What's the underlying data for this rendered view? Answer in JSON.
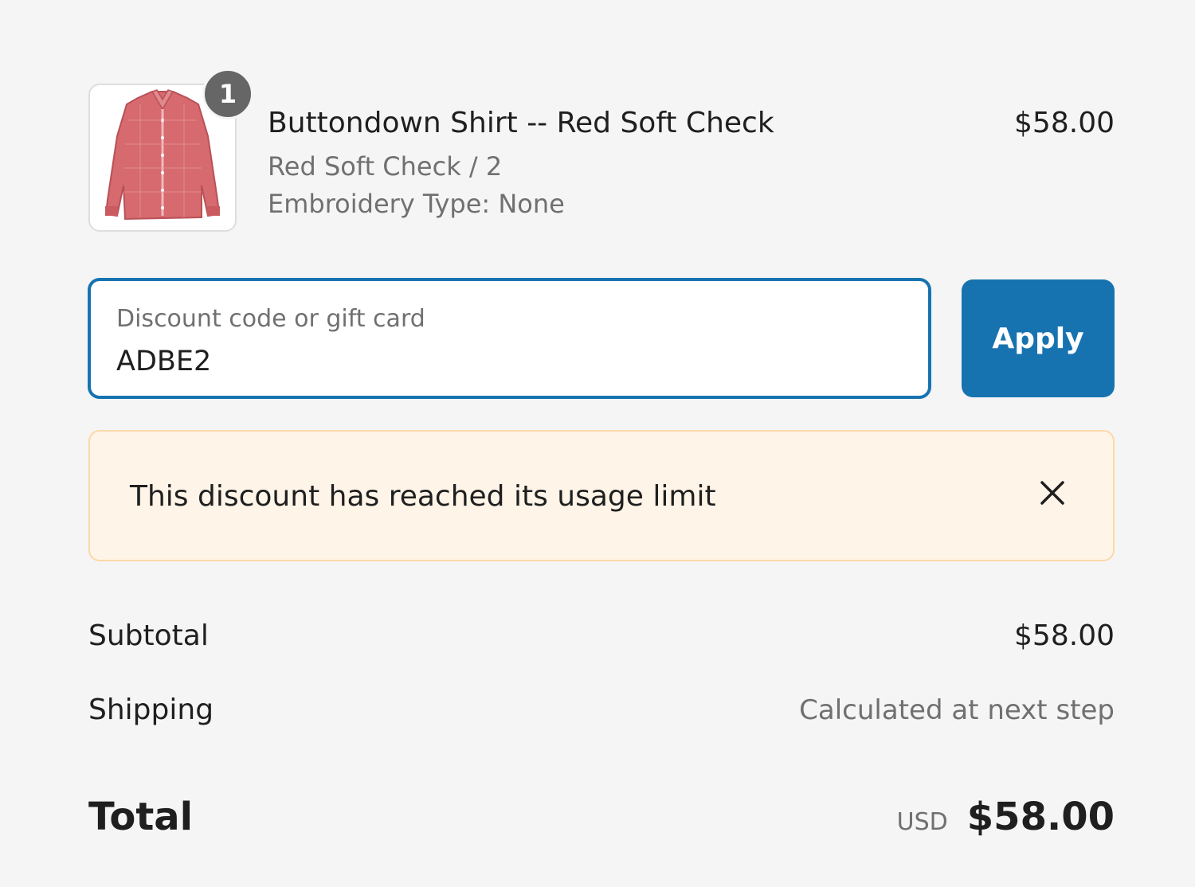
{
  "line_item": {
    "quantity": "1",
    "title": "Buttondown Shirt -- Red Soft Check",
    "variant": "Red Soft Check / 2",
    "option": "Embroidery Type: None",
    "price": "$58.00",
    "image_icon": "shirt-image"
  },
  "discount": {
    "label": "Discount code or gift card",
    "value": "ADBE2",
    "apply_label": "Apply"
  },
  "banner": {
    "message": "This discount has reached its usage limit",
    "close_icon": "close-icon"
  },
  "summary": {
    "subtotal_label": "Subtotal",
    "subtotal_value": "$58.00",
    "shipping_label": "Shipping",
    "shipping_value": "Calculated at next step",
    "total_label": "Total",
    "currency": "USD",
    "total_value": "$58.00"
  },
  "colors": {
    "accent": "#1773b0",
    "background": "#f5f5f5",
    "warning_bg": "#fff4e8",
    "warning_border": "#fcd8a8",
    "badge": "#666666",
    "muted_text": "#707070"
  }
}
